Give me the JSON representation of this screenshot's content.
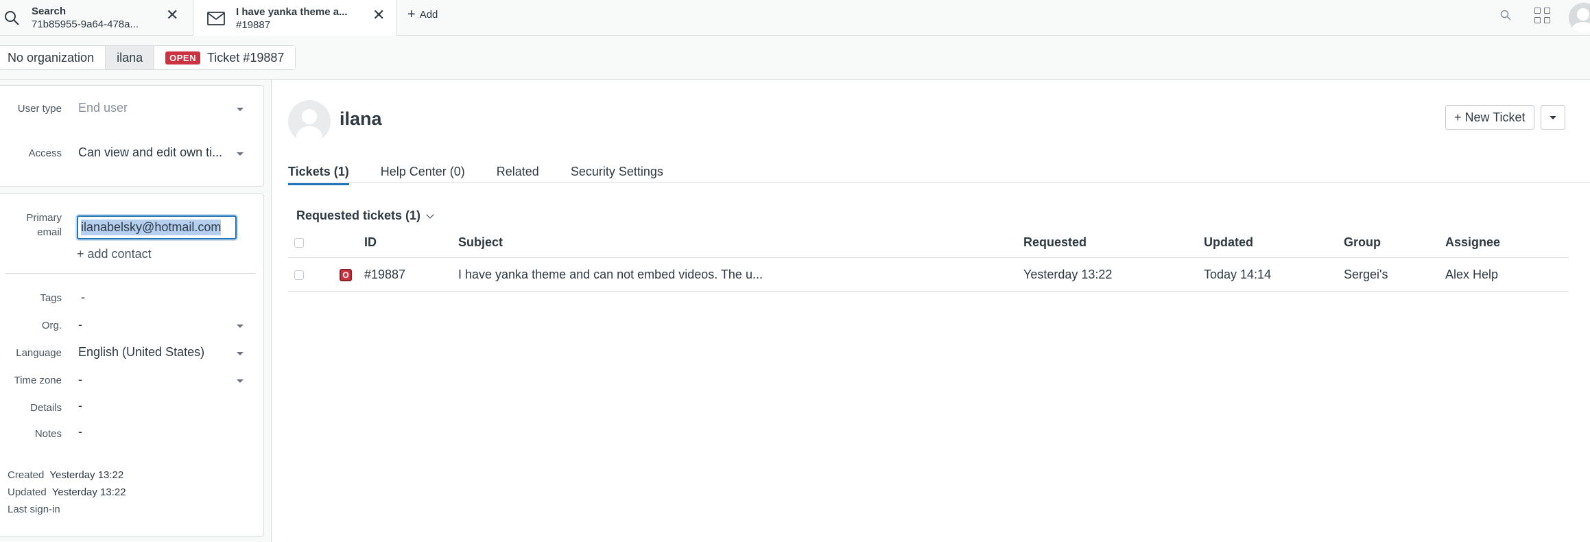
{
  "tabs": [
    {
      "line1": "Search",
      "line2": "71b85955-9a64-478a..."
    },
    {
      "line1": "I have yanka theme a...",
      "line2": "#19887"
    }
  ],
  "add_tab_label": "Add",
  "breadcrumb": {
    "org": "No organization",
    "user": "ilana",
    "status_badge": "OPEN",
    "ticket": "Ticket #19887"
  },
  "user_fields": {
    "user_type_label": "User type",
    "user_type_value": "End user",
    "access_label": "Access",
    "access_value": "Can view and edit own ti...",
    "primary_email_label_1": "Primary",
    "primary_email_label_2": "email",
    "primary_email_value": "ilanabelsky@hotmail.com",
    "add_contact": "+ add contact",
    "tags_label": "Tags",
    "tags_value": "-",
    "org_label": "Org.",
    "org_value": "-",
    "language_label": "Language",
    "language_value": "English (United States)",
    "timezone_label": "Time zone",
    "timezone_value": "-",
    "details_label": "Details",
    "details_value": "-",
    "notes_label": "Notes",
    "notes_value": "-"
  },
  "meta": {
    "created_label": "Created",
    "created_value": "Yesterday 13:22",
    "updated_label": "Updated",
    "updated_value": "Yesterday 13:22",
    "last_signin_label": "Last sign-in"
  },
  "profile": {
    "name": "ilana",
    "new_ticket": "+ New Ticket"
  },
  "profile_tabs": [
    "Tickets (1)",
    "Help Center (0)",
    "Related",
    "Security Settings"
  ],
  "requested": {
    "title": "Requested tickets (1)",
    "columns": [
      "ID",
      "Subject",
      "Requested",
      "Updated",
      "Group",
      "Assignee"
    ],
    "rows": [
      {
        "status": "O",
        "id": "#19887",
        "subject": "I have yanka theme and can not embed videos. The u...",
        "requested": "Yesterday 13:22",
        "updated": "Today 14:14",
        "group": "Sergei's",
        "assignee": "Alex Help"
      }
    ]
  },
  "colors": {
    "accent": "#1f73b7",
    "open_status": "#cc3340"
  }
}
